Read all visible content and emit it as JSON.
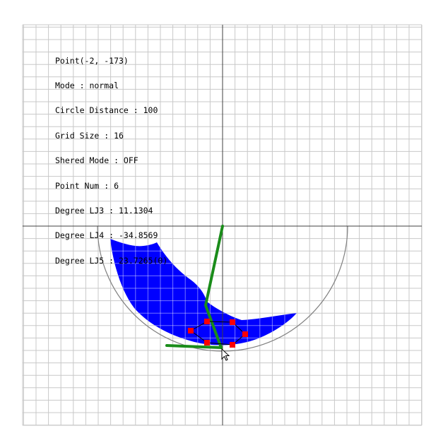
{
  "info": {
    "point": "Point(-2, -173)",
    "mode": "Mode : normal",
    "circle_distance": "Circle Distance : 100",
    "grid_size": "Grid Size : 16",
    "shered_mode": "Shered Mode : OFF",
    "point_num": "Point Num : 6",
    "degree_lj3": "Degree LJ3 : 11.1304",
    "degree_lj4": "Degree LJ4 : -34.8569",
    "degree_lj5": "Degree LJ5 : 23.7265(0)"
  },
  "colors": {
    "background": "#ffffff",
    "grid": "#c8c8c8",
    "axis": "#404040",
    "circle": "#808080",
    "workspace_fill": "#0000ff",
    "arm": "#1a8c1a",
    "control_point": "#ff0000",
    "text": "#000000"
  },
  "grid": {
    "size": 16
  },
  "cursor": {
    "icon": "arrow-cursor-icon"
  }
}
